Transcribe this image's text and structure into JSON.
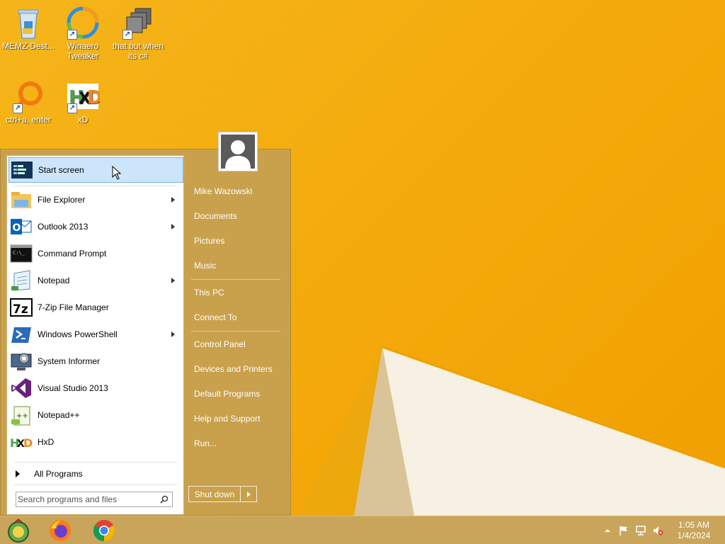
{
  "desktop": {
    "icons": [
      {
        "label": "MEMZ-Dest...",
        "icon": "recycle-bin-icon"
      },
      {
        "label": "Winaero Tweaker",
        "icon": "winaero-icon"
      },
      {
        "label": "that but when its c#",
        "icon": "stacked-windows-icon"
      },
      {
        "label": "ctrl+a, enter",
        "icon": "magnifier-ring-icon"
      },
      {
        "label": "xD",
        "icon": "hxd-icon"
      }
    ]
  },
  "start_menu": {
    "items": [
      {
        "label": "Start screen",
        "icon": "start-screen-icon",
        "submenu": false
      },
      {
        "label": "File Explorer",
        "icon": "file-explorer-icon",
        "submenu": true
      },
      {
        "label": "Outlook 2013",
        "icon": "outlook-icon",
        "submenu": true
      },
      {
        "label": "Command Prompt",
        "icon": "command-prompt-icon",
        "submenu": false
      },
      {
        "label": "Notepad",
        "icon": "notepad-icon",
        "submenu": true
      },
      {
        "label": "7-Zip File Manager",
        "icon": "7zip-icon",
        "submenu": false
      },
      {
        "label": "Windows PowerShell",
        "icon": "powershell-icon",
        "submenu": true
      },
      {
        "label": "System Informer",
        "icon": "system-informer-icon",
        "submenu": false
      },
      {
        "label": "Visual Studio 2013",
        "icon": "visual-studio-icon",
        "submenu": false
      },
      {
        "label": "Notepad++",
        "icon": "notepadpp-icon",
        "submenu": false
      },
      {
        "label": "HxD",
        "icon": "hxd-icon",
        "submenu": false
      }
    ],
    "all_programs": "All Programs",
    "search_placeholder": "Search programs and files",
    "right_items": [
      {
        "label": "Mike Wazowski"
      },
      {
        "label": "Documents"
      },
      {
        "label": "Pictures"
      },
      {
        "label": "Music"
      },
      {
        "label": "This PC"
      },
      {
        "label": "Connect To"
      },
      {
        "label": "Control Panel"
      },
      {
        "label": "Devices and Printers"
      },
      {
        "label": "Default Programs"
      },
      {
        "label": "Help and Support"
      },
      {
        "label": "Run..."
      }
    ],
    "shutdown_label": "Shut down"
  },
  "taskbar": {
    "pinned": [
      "start-orb-icon",
      "firefox-icon",
      "chrome-icon"
    ],
    "clock_time": "1:05 AM",
    "clock_date": "1/4/2024"
  },
  "colors": {
    "wallpaper": "#f4a90a",
    "highlight": "#cde5fb",
    "taskbar": "#c8a55a"
  }
}
